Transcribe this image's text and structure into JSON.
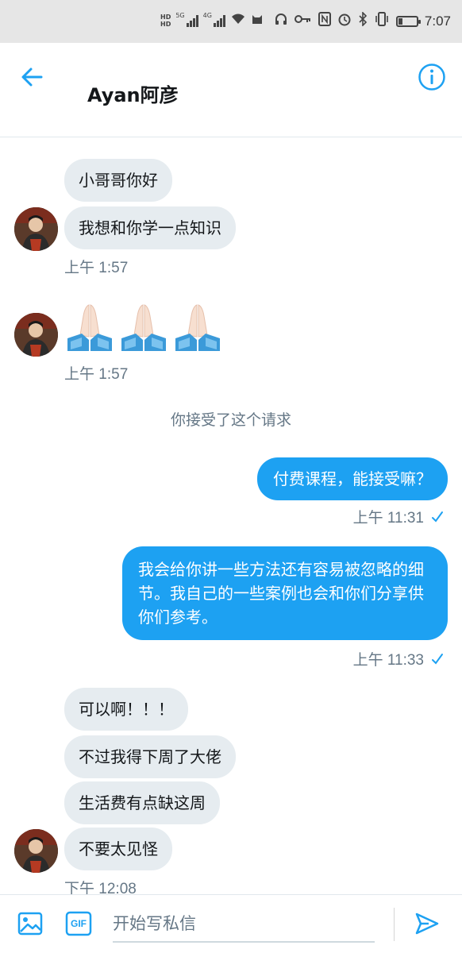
{
  "status_bar": {
    "hd_top": "HD",
    "hd_bottom": "HD",
    "net1": "5G",
    "net2": "4G",
    "battery_level": 0.25,
    "time": "7:07"
  },
  "header": {
    "title": "Ayan阿彦"
  },
  "messages": {
    "in1": "小哥哥你好",
    "in2": "我想和你学一点知识",
    "ts1": "上午 1:57",
    "ts2": "上午 1:57",
    "emoji": [
      "🙏🏻",
      "🙏🏻",
      "🙏🏻"
    ],
    "system": "你接受了这个请求",
    "out1": "付费课程，能接受嘛？",
    "ts3": "上午 11:31",
    "out2": "我会给你讲一些方法还有容易被忽略的细节。我自己的一些案例也会和你们分享供你们参考。",
    "ts4": "上午 11:33",
    "in3": "可以啊！！！",
    "in4": "不过我得下周了大佬",
    "in5": "生活费有点缺这周",
    "in6": "不要太见怪",
    "ts5": "下午 12:08"
  },
  "composer": {
    "placeholder": "开始写私信",
    "gif_label": "GIF"
  },
  "colors": {
    "accent": "#1da1f2",
    "incoming_bubble": "#e6ecf0",
    "muted": "#657786"
  }
}
